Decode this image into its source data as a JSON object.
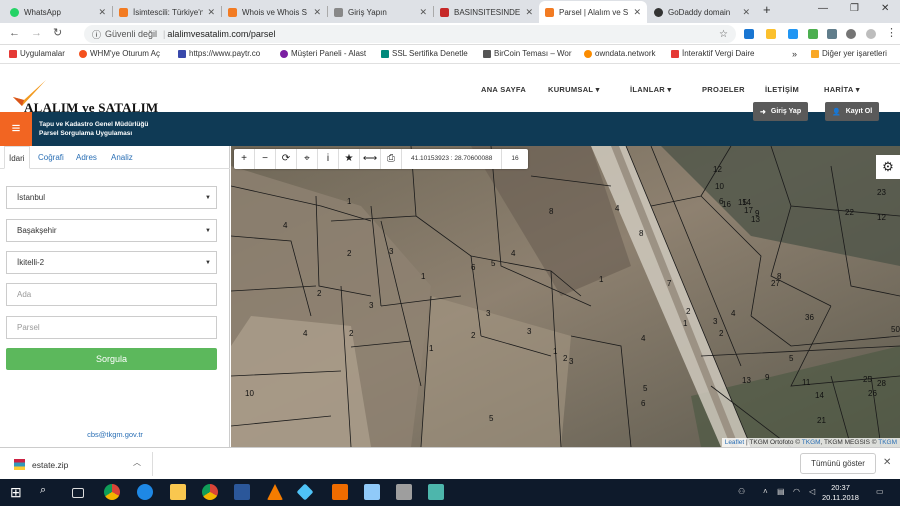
{
  "browser": {
    "tabs": [
      {
        "title": "WhatsApp",
        "color": "#25d366"
      },
      {
        "title": "İsimtescili: Türkiye'n",
        "color": "#f27b22"
      },
      {
        "title": "Whois ve Whois S",
        "color": "#f27b22"
      },
      {
        "title": "Giriş Yapın",
        "color": "#888"
      },
      {
        "title": "BASINSITESINDE İ",
        "color": "#c62828"
      },
      {
        "title": "Parsel | Alalım ve S",
        "color": "#f27b22"
      },
      {
        "title": "GoDaddy domain",
        "color": "#333"
      }
    ],
    "new_tab": "+",
    "address": {
      "secure_label": "Güvenli değil",
      "url": "alalimvesatalim.com/parsel"
    },
    "bookmarks": [
      {
        "label": "Uygulamalar",
        "color": "#e53935"
      },
      {
        "label": "WHM'ye Oturum Aç",
        "color": "#f4511e"
      },
      {
        "label": "https://www.paytr.co",
        "color": "#3949ab"
      },
      {
        "label": "Müşteri Paneli - Alast",
        "color": "#7b1fa2"
      },
      {
        "label": "SSL Sertifika Denetle",
        "color": "#00897b"
      },
      {
        "label": "BirCoin Teması – Wor",
        "color": "#555"
      },
      {
        "label": "owndata.network",
        "color": "#fb8c00"
      },
      {
        "label": "İnteraktif Vergi Daire",
        "color": "#e53935"
      }
    ],
    "bookmarks_more": "»",
    "other_bookmarks": "Diğer yer işaretleri"
  },
  "site": {
    "logo_text": "ALALIM ve SATALIM",
    "nav": [
      "ANA SAYFA",
      "KURUMSAL",
      "İLANLAR",
      "PROJELER",
      "İLETİŞİM",
      "HARİTA"
    ],
    "subtitle_line1": "Tapu ve Kadastro Genel Müdürlüğü",
    "subtitle_line2": "Parsel Sorgulama Uygulaması",
    "login": "Giriş Yap",
    "register": "Kayıt Ol"
  },
  "sidebar": {
    "tabs": [
      "İdari",
      "Coğrafi",
      "Adres",
      "Analiz"
    ],
    "province": "İstanbul",
    "district": "Başakşehir",
    "neighborhood": "İkitelli-2",
    "ada_placeholder": "Ada",
    "parsel_placeholder": "Parsel",
    "query_button": "Sorgula",
    "email": "cbs@tkgm.gov.tr"
  },
  "map": {
    "tools": [
      "+",
      "−",
      "⟳",
      "⌖",
      "i",
      "★",
      "⟷",
      "⎙"
    ],
    "coords": "41.10153923 : 28.70600088",
    "zoom": "16",
    "attribution_link": "Leaflet",
    "attribution_text": " | TKGM Ortofoto © ",
    "attribution_tkgm": "TKGM",
    "attribution_text2": ", TKGM MEGSIS © ",
    "attribution_tkgm2": "TKGM",
    "parcel_labels": [
      "1",
      "4",
      "2",
      "3",
      "2",
      "4",
      "1",
      "6",
      "5",
      "4",
      "3",
      "2",
      "1",
      "3",
      "2",
      "3",
      "1",
      "10",
      "5",
      "2",
      "4",
      "8",
      "1",
      "3",
      "4",
      "5",
      "6",
      "8",
      "7",
      "2",
      "1",
      "2",
      "3",
      "4",
      "5",
      "36",
      "13",
      "9",
      "11",
      "14",
      "21",
      "25",
      "28",
      "26",
      "23",
      "22",
      "17",
      "16",
      "15",
      "14",
      "13",
      "12",
      "10",
      "12",
      "50",
      "9",
      "8",
      "6",
      "27"
    ]
  },
  "download": {
    "file": "estate.zip",
    "show_all": "Tümünü göster"
  },
  "taskbar": {
    "time": "20:37",
    "date": "20.11.2018"
  }
}
